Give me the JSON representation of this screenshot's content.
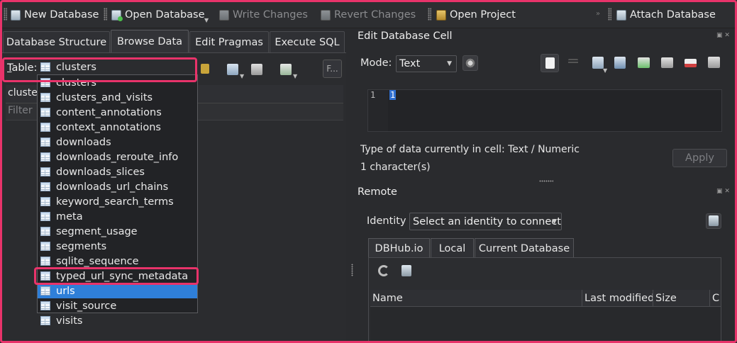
{
  "toolbar": {
    "new_database": "New Database",
    "open_database": "Open Database",
    "write_changes": "Write Changes",
    "revert_changes": "Revert Changes",
    "open_project": "Open Project",
    "attach_database": "Attach Database"
  },
  "tabs": [
    {
      "label": "Database Structure"
    },
    {
      "label": "Browse Data"
    },
    {
      "label": "Edit Pragmas"
    },
    {
      "label": "Execute SQL"
    }
  ],
  "browse": {
    "table_label": "able:",
    "table_label_underlined": "T",
    "selected_table": "clusters",
    "column_header": "cluster",
    "filter_placeholder": "Filter",
    "filter_button": "F..."
  },
  "table_dropdown": {
    "items": [
      "clusters",
      "clusters_and_visits",
      "content_annotations",
      "context_annotations",
      "downloads",
      "downloads_reroute_info",
      "downloads_slices",
      "downloads_url_chains",
      "keyword_search_terms",
      "meta",
      "segment_usage",
      "segments",
      "sqlite_sequence",
      "typed_url_sync_metadata",
      "urls",
      "visit_source",
      "visits"
    ],
    "highlighted": "urls"
  },
  "edit_cell": {
    "title": "Edit Database Cell",
    "mode_label": "Mode:",
    "mode_value": "Text",
    "line_number": "1",
    "cell_value": "1",
    "type_info": "Type of data currently in cell: Text / Numeric",
    "size_info": "1 character(s)",
    "apply_label": "Apply"
  },
  "remote": {
    "title": "Remote",
    "identity_label": "Identity",
    "identity_value": "Select an identity to connect",
    "tabs": [
      {
        "label": "DBHub.io"
      },
      {
        "label": "Local"
      },
      {
        "label": "Current Database"
      }
    ],
    "columns": [
      "Name",
      "Last modified",
      "Size",
      "C"
    ]
  },
  "colors": {
    "highlight": "#e8336a",
    "selection": "#2f7fd8",
    "background": "#2a2b2e"
  }
}
